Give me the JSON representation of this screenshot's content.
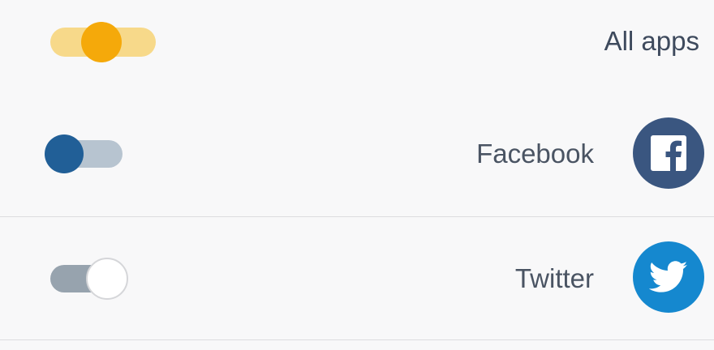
{
  "colors": {
    "background": "#f8f8f9",
    "divider": "#dcdcdf",
    "all_apps_track": "#f7d98a",
    "all_apps_knob": "#f5a90a",
    "facebook_knob": "#215f97",
    "facebook_track": "#b7c4d0",
    "facebook_brand": "#3a5680",
    "twitter_track": "#97a3ae",
    "twitter_knob": "#ffffff",
    "twitter_brand": "#1588cf"
  },
  "rows": {
    "all_apps": {
      "label": "All apps",
      "toggle_icon": "toggle-switch"
    },
    "facebook": {
      "label": "Facebook",
      "app_icon": "facebook-icon",
      "toggle_icon": "toggle-switch"
    },
    "twitter": {
      "label": "Twitter",
      "app_icon": "twitter-icon",
      "toggle_icon": "toggle-switch"
    }
  }
}
